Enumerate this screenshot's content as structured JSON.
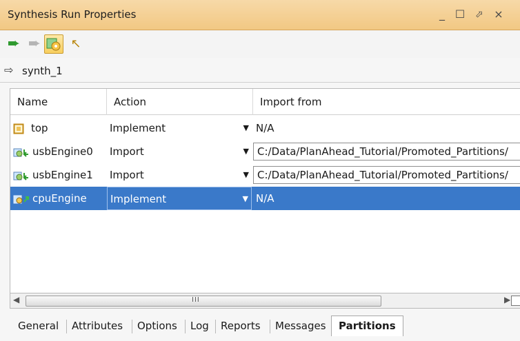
{
  "window": {
    "title": "Synthesis Run Properties",
    "controls": [
      "minimize-icon",
      "maximize-icon",
      "float-icon",
      "close-icon"
    ]
  },
  "toolbar": {
    "buttons": [
      {
        "icon": "back-arrow-icon",
        "color": "#2f9a2f"
      },
      {
        "icon": "forward-arrow-icon",
        "color": "#b9b9b9"
      },
      {
        "icon": "gear-settings-icon",
        "active": true
      },
      {
        "icon": "pointer-icon"
      }
    ]
  },
  "breadcrumb": {
    "label": "synth_1"
  },
  "table": {
    "columns": [
      "Name",
      "Action",
      "Import from"
    ],
    "rows": [
      {
        "name": "top",
        "action": "Implement",
        "import_from": "N/A",
        "icon": "partition-box-icon",
        "selected": false
      },
      {
        "name": "usbEngine0",
        "action": "Import",
        "import_from": "C:/Data/PlanAhead_Tutorial/Promoted_Partitions/",
        "icon": "partition-import-icon",
        "selected": false
      },
      {
        "name": "usbEngine1",
        "action": "Import",
        "import_from": "C:/Data/PlanAhead_Tutorial/Promoted_Partitions/",
        "icon": "partition-import-icon",
        "selected": false
      },
      {
        "name": "cpuEngine",
        "action": "Implement",
        "import_from": "N/A",
        "icon": "partition-implement-icon",
        "selected": true
      }
    ]
  },
  "scrollbar": {
    "grip": "III"
  },
  "tabs": [
    "General",
    "Attributes",
    "Options",
    "Log",
    "Reports",
    "Messages",
    "Partitions"
  ],
  "active_tab": "Partitions",
  "colors": {
    "titlebar": "#f2c883",
    "selection": "#3a79c9"
  }
}
